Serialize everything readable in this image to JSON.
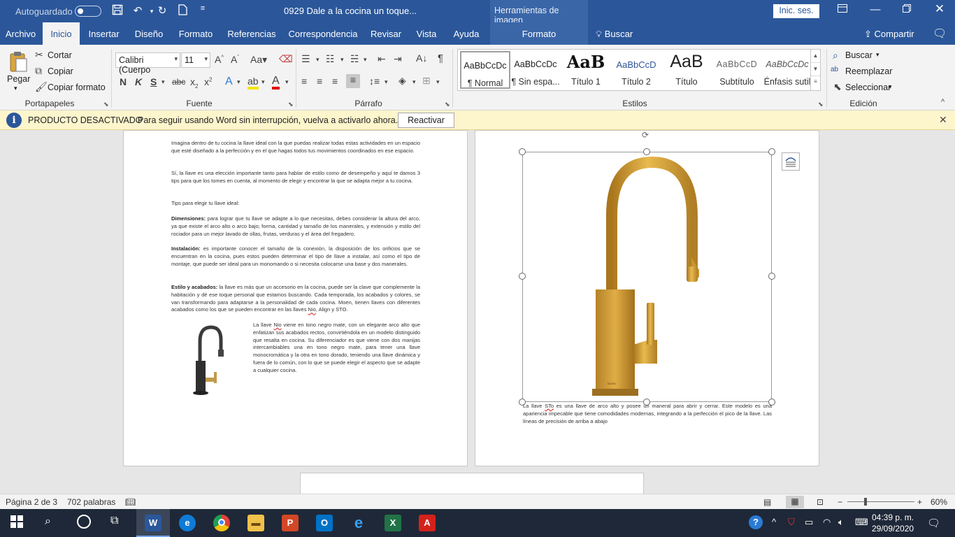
{
  "titlebar": {
    "autosave_label": "Autoguardado",
    "doc_title": "0929 Dale a la cocina un toque...",
    "context_tools": "Herramientas de imagen",
    "signin": "Inic. ses."
  },
  "tabs": [
    "Archivo",
    "Inicio",
    "Insertar",
    "Diseño",
    "Formato",
    "Referencias",
    "Correspondencia",
    "Revisar",
    "Vista",
    "Ayuda"
  ],
  "context_tab": "Formato",
  "tell_me": "Buscar",
  "share": "Compartir",
  "ribbon": {
    "clipboard": {
      "paste": "Pegar",
      "cut": "Cortar",
      "copy": "Copiar",
      "format_painter": "Copiar formato",
      "label": "Portapapeles"
    },
    "font": {
      "name": "Calibri (Cuerpo",
      "size": "11",
      "label": "Fuente"
    },
    "paragraph": {
      "label": "Párrafo"
    },
    "styles": {
      "label": "Estilos",
      "items": [
        {
          "sample": "AaBbCcDc",
          "name": "¶ Normal"
        },
        {
          "sample": "AaBbCcDc",
          "name": "¶ Sin espa..."
        },
        {
          "sample": "AaB",
          "name": "Título 1"
        },
        {
          "sample": "AaBbCcD",
          "name": "Título 2"
        },
        {
          "sample": "AaB",
          "name": "Título"
        },
        {
          "sample": "AaBbCcD",
          "name": "Subtítulo"
        },
        {
          "sample": "AaBbCcDc",
          "name": "Énfasis sutil"
        }
      ]
    },
    "editing": {
      "find": "Buscar",
      "replace": "Reemplazar",
      "select": "Seleccionar",
      "label": "Edición"
    }
  },
  "message_bar": {
    "title": "PRODUCTO DESACTIVADO",
    "text": "Para seguir usando Word sin interrupción, vuelva a activarlo ahora.",
    "button": "Reactivar"
  },
  "document": {
    "p1": "Imagina dentro de tu cocina la llave ideal con la que puedas realizar todas estas actividades en un espacio que esté diseñado a la perfección y en el que hagas todos tus movimientos coordinados en ese espacio.",
    "p2": "Sí, la llave es una elección importante tanto para hablar de estilo como de desempeño y aquí te damos 3 tips para que los tomes en cuenta, al momento de elegir y encontrar la que se adapta mejor a tu cocina.",
    "p3": "Tips para elegir tu llave ideal:",
    "p4_bold": "Dimensiones:",
    "p4": " para lograr que tu llave se adapte a lo que necesitas, debes considerar la altura del arco, ya que existe el arco alto o arco bajo; forma, cantidad y tamaño de los maneral­es, y extensión y estilo del rociador para un mejor lavado de ollas, frutas, verduras y el área del fregadero.",
    "p5_bold": "Instalación:",
    "p5": " es importante conocer el tamaño de la conexión, la disposición de los orificios que se encuentran en la cocina, pues estos pueden determinar el tipo de llave a instalar, así como el tipo de montaje, que puede ser ideal para un monomando o si necesita colocarse una base y dos manerales.",
    "p6_bold": "Estilo y acabados:",
    "p6_a": " la llave es más que un accesorio en la cocina, puede ser la clave que complemente la habitación y dé ese toque personal que estamos buscando. Cada temporada, los acabados y colores, se van transformando para adaptarse a la personalidad de cada cocina. Moen, tienen llaves con diferentes acabados como los que se pueden encontrar en las llaves ",
    "p6_nio": "Nio",
    "p6_b": ", Align y STO.",
    "p7_a": "La llave ",
    "p7_nio": "Nio",
    "p7_b": " viene en tono negro mate, con un elegante arco alto que enfatizan sus acabados rectos, convirtiéndola en un modelo distinguido que resalta en cocina. Su diferenciador es que viene con dos manijas intercambiables una en tono negro mate, para tener una llave monocromática y la otra en tono dorado, teniendo una llave dinámica y fuera de lo común, con lo que se puede elegir el aspecto que se adapte a cualquier cocina.",
    "p8_a": "La llave ",
    "p8_sto": "STo",
    "p8_b": " es una llave de arco alto y posee un maneral para abrir y cerrar. Este modelo es una apariencia impecable que tiene comodidades modernas, integrando a la perfección el pico de la llave. Las líneas de precisión de arriba a abajo"
  },
  "statusbar": {
    "page": "Página 2 de 3",
    "words": "702 palabras",
    "zoom": "60%"
  },
  "taskbar": {
    "time": "04:39 p. m.",
    "date": "29/09/2020"
  },
  "colors": {
    "word_blue": "#2b579a",
    "gold": "#c9952f",
    "message_bar": "#fdf5cc"
  }
}
